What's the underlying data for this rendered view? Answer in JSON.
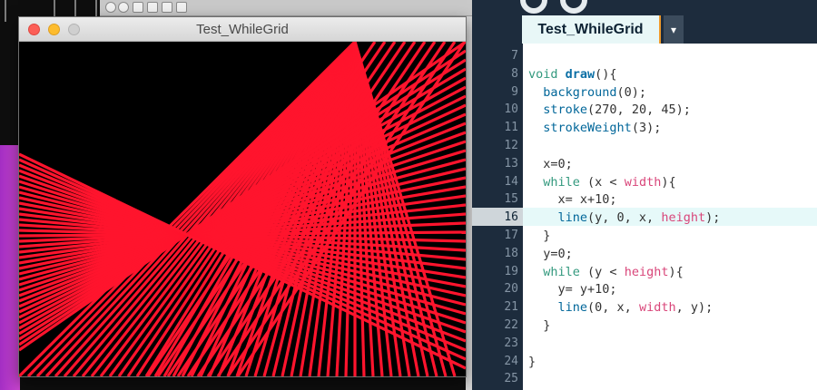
{
  "window": {
    "title": "Test_WhileGrid"
  },
  "editor": {
    "tab_label": "Test_WhileGrid",
    "tab_menu_icon": "▾",
    "active_line": 16,
    "lines": [
      {
        "num": "7",
        "parts": []
      },
      {
        "num": "8",
        "parts": [
          {
            "t": "void ",
            "c": "kw"
          },
          {
            "t": "draw",
            "c": "fn"
          },
          {
            "t": "(){",
            "c": "tk"
          }
        ]
      },
      {
        "num": "9",
        "parts": [
          {
            "t": "  ",
            "c": "tk"
          },
          {
            "t": "background",
            "c": "fc"
          },
          {
            "t": "(0);",
            "c": "tk"
          }
        ]
      },
      {
        "num": "10",
        "parts": [
          {
            "t": "  ",
            "c": "tk"
          },
          {
            "t": "stroke",
            "c": "fc"
          },
          {
            "t": "(270, 20, 45);",
            "c": "tk"
          }
        ]
      },
      {
        "num": "11",
        "parts": [
          {
            "t": "  ",
            "c": "tk"
          },
          {
            "t": "strokeWeight",
            "c": "fc"
          },
          {
            "t": "(3);",
            "c": "tk"
          }
        ]
      },
      {
        "num": "12",
        "parts": []
      },
      {
        "num": "13",
        "parts": [
          {
            "t": "  x=0;",
            "c": "tk"
          }
        ]
      },
      {
        "num": "14",
        "parts": [
          {
            "t": "  ",
            "c": "tk"
          },
          {
            "t": "while",
            "c": "kw"
          },
          {
            "t": " (x < ",
            "c": "tk"
          },
          {
            "t": "width",
            "c": "ct"
          },
          {
            "t": "){",
            "c": "tk"
          }
        ]
      },
      {
        "num": "15",
        "parts": [
          {
            "t": "    x= x+10;",
            "c": "tk"
          }
        ]
      },
      {
        "num": "16",
        "parts": [
          {
            "t": "    ",
            "c": "tk"
          },
          {
            "t": "line",
            "c": "fc"
          },
          {
            "t": "(y, 0, x, ",
            "c": "tk"
          },
          {
            "t": "height",
            "c": "ct"
          },
          {
            "t": ");",
            "c": "tk"
          }
        ]
      },
      {
        "num": "17",
        "parts": [
          {
            "t": "  }",
            "c": "tk"
          }
        ]
      },
      {
        "num": "18",
        "parts": [
          {
            "t": "  y=0;",
            "c": "tk"
          }
        ]
      },
      {
        "num": "19",
        "parts": [
          {
            "t": "  ",
            "c": "tk"
          },
          {
            "t": "while",
            "c": "kw"
          },
          {
            "t": " (y < ",
            "c": "tk"
          },
          {
            "t": "height",
            "c": "ct"
          },
          {
            "t": "){",
            "c": "tk"
          }
        ]
      },
      {
        "num": "20",
        "parts": [
          {
            "t": "    y= y+10;",
            "c": "tk"
          }
        ]
      },
      {
        "num": "21",
        "parts": [
          {
            "t": "    ",
            "c": "tk"
          },
          {
            "t": "line",
            "c": "fc"
          },
          {
            "t": "(0, x, ",
            "c": "tk"
          },
          {
            "t": "width",
            "c": "ct"
          },
          {
            "t": ", y);",
            "c": "tk"
          }
        ]
      },
      {
        "num": "22",
        "parts": [
          {
            "t": "  }",
            "c": "tk"
          }
        ]
      },
      {
        "num": "23",
        "parts": []
      },
      {
        "num": "24",
        "parts": [
          {
            "t": "}",
            "c": "tk"
          }
        ]
      },
      {
        "num": "25",
        "parts": []
      }
    ]
  },
  "sketch": {
    "background": "#000000",
    "stroke_color": "#ff142d",
    "icons": [
      "close-icon",
      "minimize-icon",
      "zoom-icon"
    ]
  },
  "colors": {
    "editor_bg": "#1d2c3d",
    "tab_bg": "#e8f7f7",
    "tab_accent": "#f19a2a",
    "keyword": "#33997e",
    "function": "#006699",
    "constant": "#d9467a"
  }
}
